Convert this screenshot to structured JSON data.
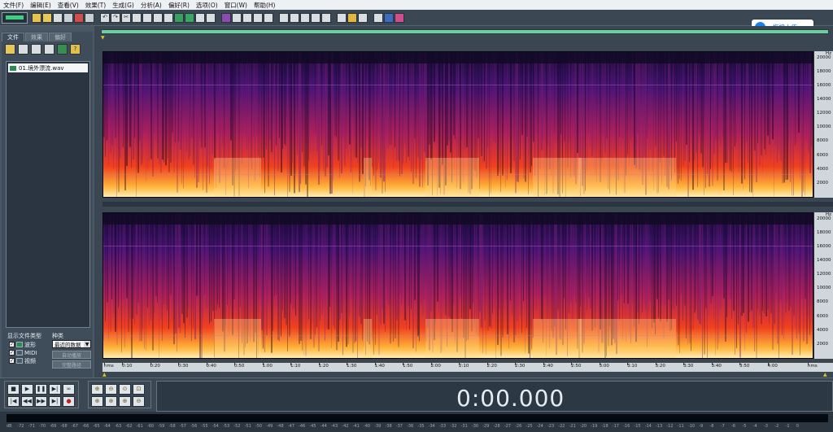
{
  "menu": [
    "文件(F)",
    "编辑(E)",
    "查看(V)",
    "效果(T)",
    "生成(G)",
    "分析(A)",
    "偏好(R)",
    "选项(O)",
    "窗口(W)",
    "帮助(H)"
  ],
  "upload_label": "拖拽上传",
  "left_tabs": [
    "文件",
    "效果",
    "偏好"
  ],
  "file_name": "01.境外漂流.wav",
  "show_type_label": "显示文件类型",
  "sort_label": "种类",
  "file_types": [
    "波形",
    "MIDI",
    "视频"
  ],
  "sort_value": "最近的数据",
  "sort_buttons": [
    "自动播放",
    "完整路径"
  ],
  "hz_unit": "Hz",
  "hz_ticks": [
    20000,
    18000,
    16000,
    14000,
    12000,
    10000,
    8000,
    6000,
    4000,
    2000
  ],
  "time_unit": "hms",
  "time_ticks": [
    "0:10",
    "0:20",
    "0:30",
    "0:40",
    "0:50",
    "1:00",
    "1:10",
    "1:20",
    "1:30",
    "1:40",
    "1:50",
    "2:00",
    "2:10",
    "2:20",
    "2:30",
    "2:40",
    "2:50",
    "3:00",
    "3:10",
    "3:20",
    "3:30",
    "3:40",
    "3:50",
    "4:00"
  ],
  "time_display": "0:00.000",
  "meter_scale": [
    "dB",
    -72,
    -71,
    -70,
    -69,
    -68,
    -67,
    -66,
    -65,
    -64,
    -63,
    -62,
    -61,
    -60,
    -59,
    -58,
    -57,
    -56,
    -55,
    -54,
    -53,
    -52,
    -51,
    -50,
    -49,
    -48,
    -47,
    -46,
    -45,
    -44,
    -43,
    -42,
    -41,
    -40,
    -39,
    -38,
    -37,
    -36,
    -35,
    -34,
    -33,
    -32,
    -31,
    -30,
    -29,
    -28,
    -27,
    -26,
    -25,
    -24,
    -23,
    -22,
    -21,
    -20,
    -19,
    -18,
    -17,
    -16,
    -15,
    -14,
    -13,
    -12,
    -11,
    -10,
    -9,
    -8,
    -7,
    -6,
    -5,
    -4,
    -3,
    -2,
    -1,
    0
  ],
  "colors": {
    "accent": "#3fd07f",
    "upload": "#1a7ff0",
    "spec_bg": "#120a26"
  }
}
